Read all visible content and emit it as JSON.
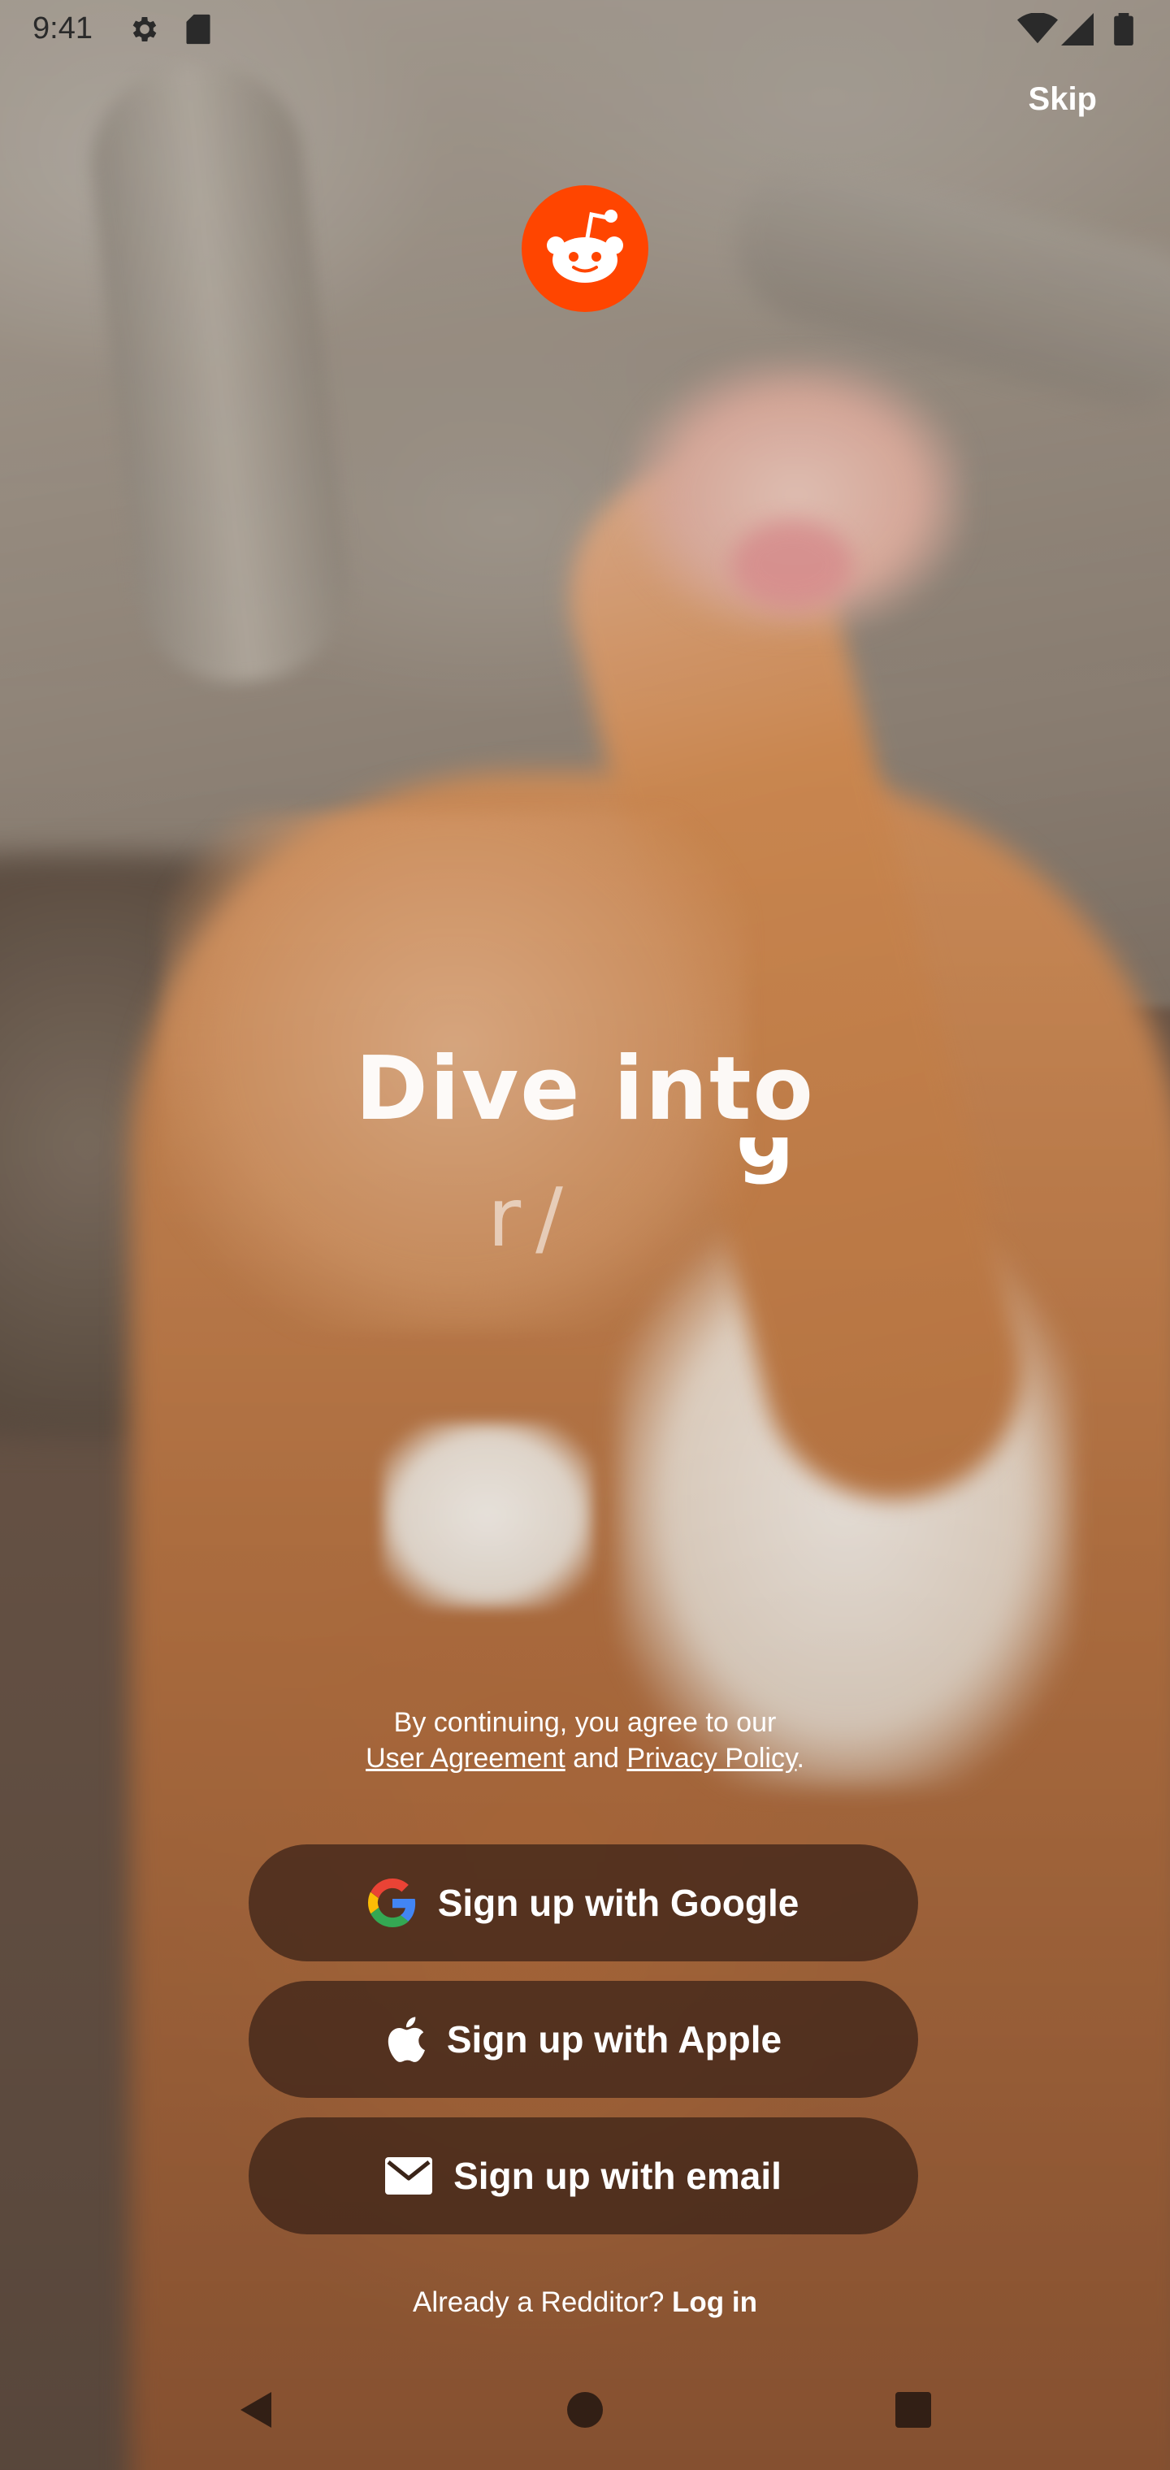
{
  "status_bar": {
    "time": "9:41",
    "icons": [
      "gear-icon",
      "sd-card-icon",
      "wifi-icon",
      "signal-icon",
      "battery-icon"
    ]
  },
  "header": {
    "skip_label": "Skip",
    "logo_icon": "reddit-snoo-icon",
    "brand_color": "#FF4500"
  },
  "hero": {
    "headline": "Dive into",
    "subline": "r/",
    "subline_fragment": "g"
  },
  "legal": {
    "line1": "By continuing, you agree to our",
    "user_agreement": "User Agreement",
    "and": "and",
    "privacy_policy": "Privacy Policy",
    "period": "."
  },
  "buttons": {
    "google": {
      "label": "Sign up with Google",
      "icon": "google-icon"
    },
    "apple": {
      "label": "Sign up with Apple",
      "icon": "apple-icon"
    },
    "email": {
      "label": "Sign up with email",
      "icon": "mail-icon"
    }
  },
  "login": {
    "prompt": "Already a Redditor?",
    "link": "Log in"
  },
  "nav_bar": {
    "icons": [
      "back-icon",
      "home-icon",
      "recents-icon"
    ]
  }
}
